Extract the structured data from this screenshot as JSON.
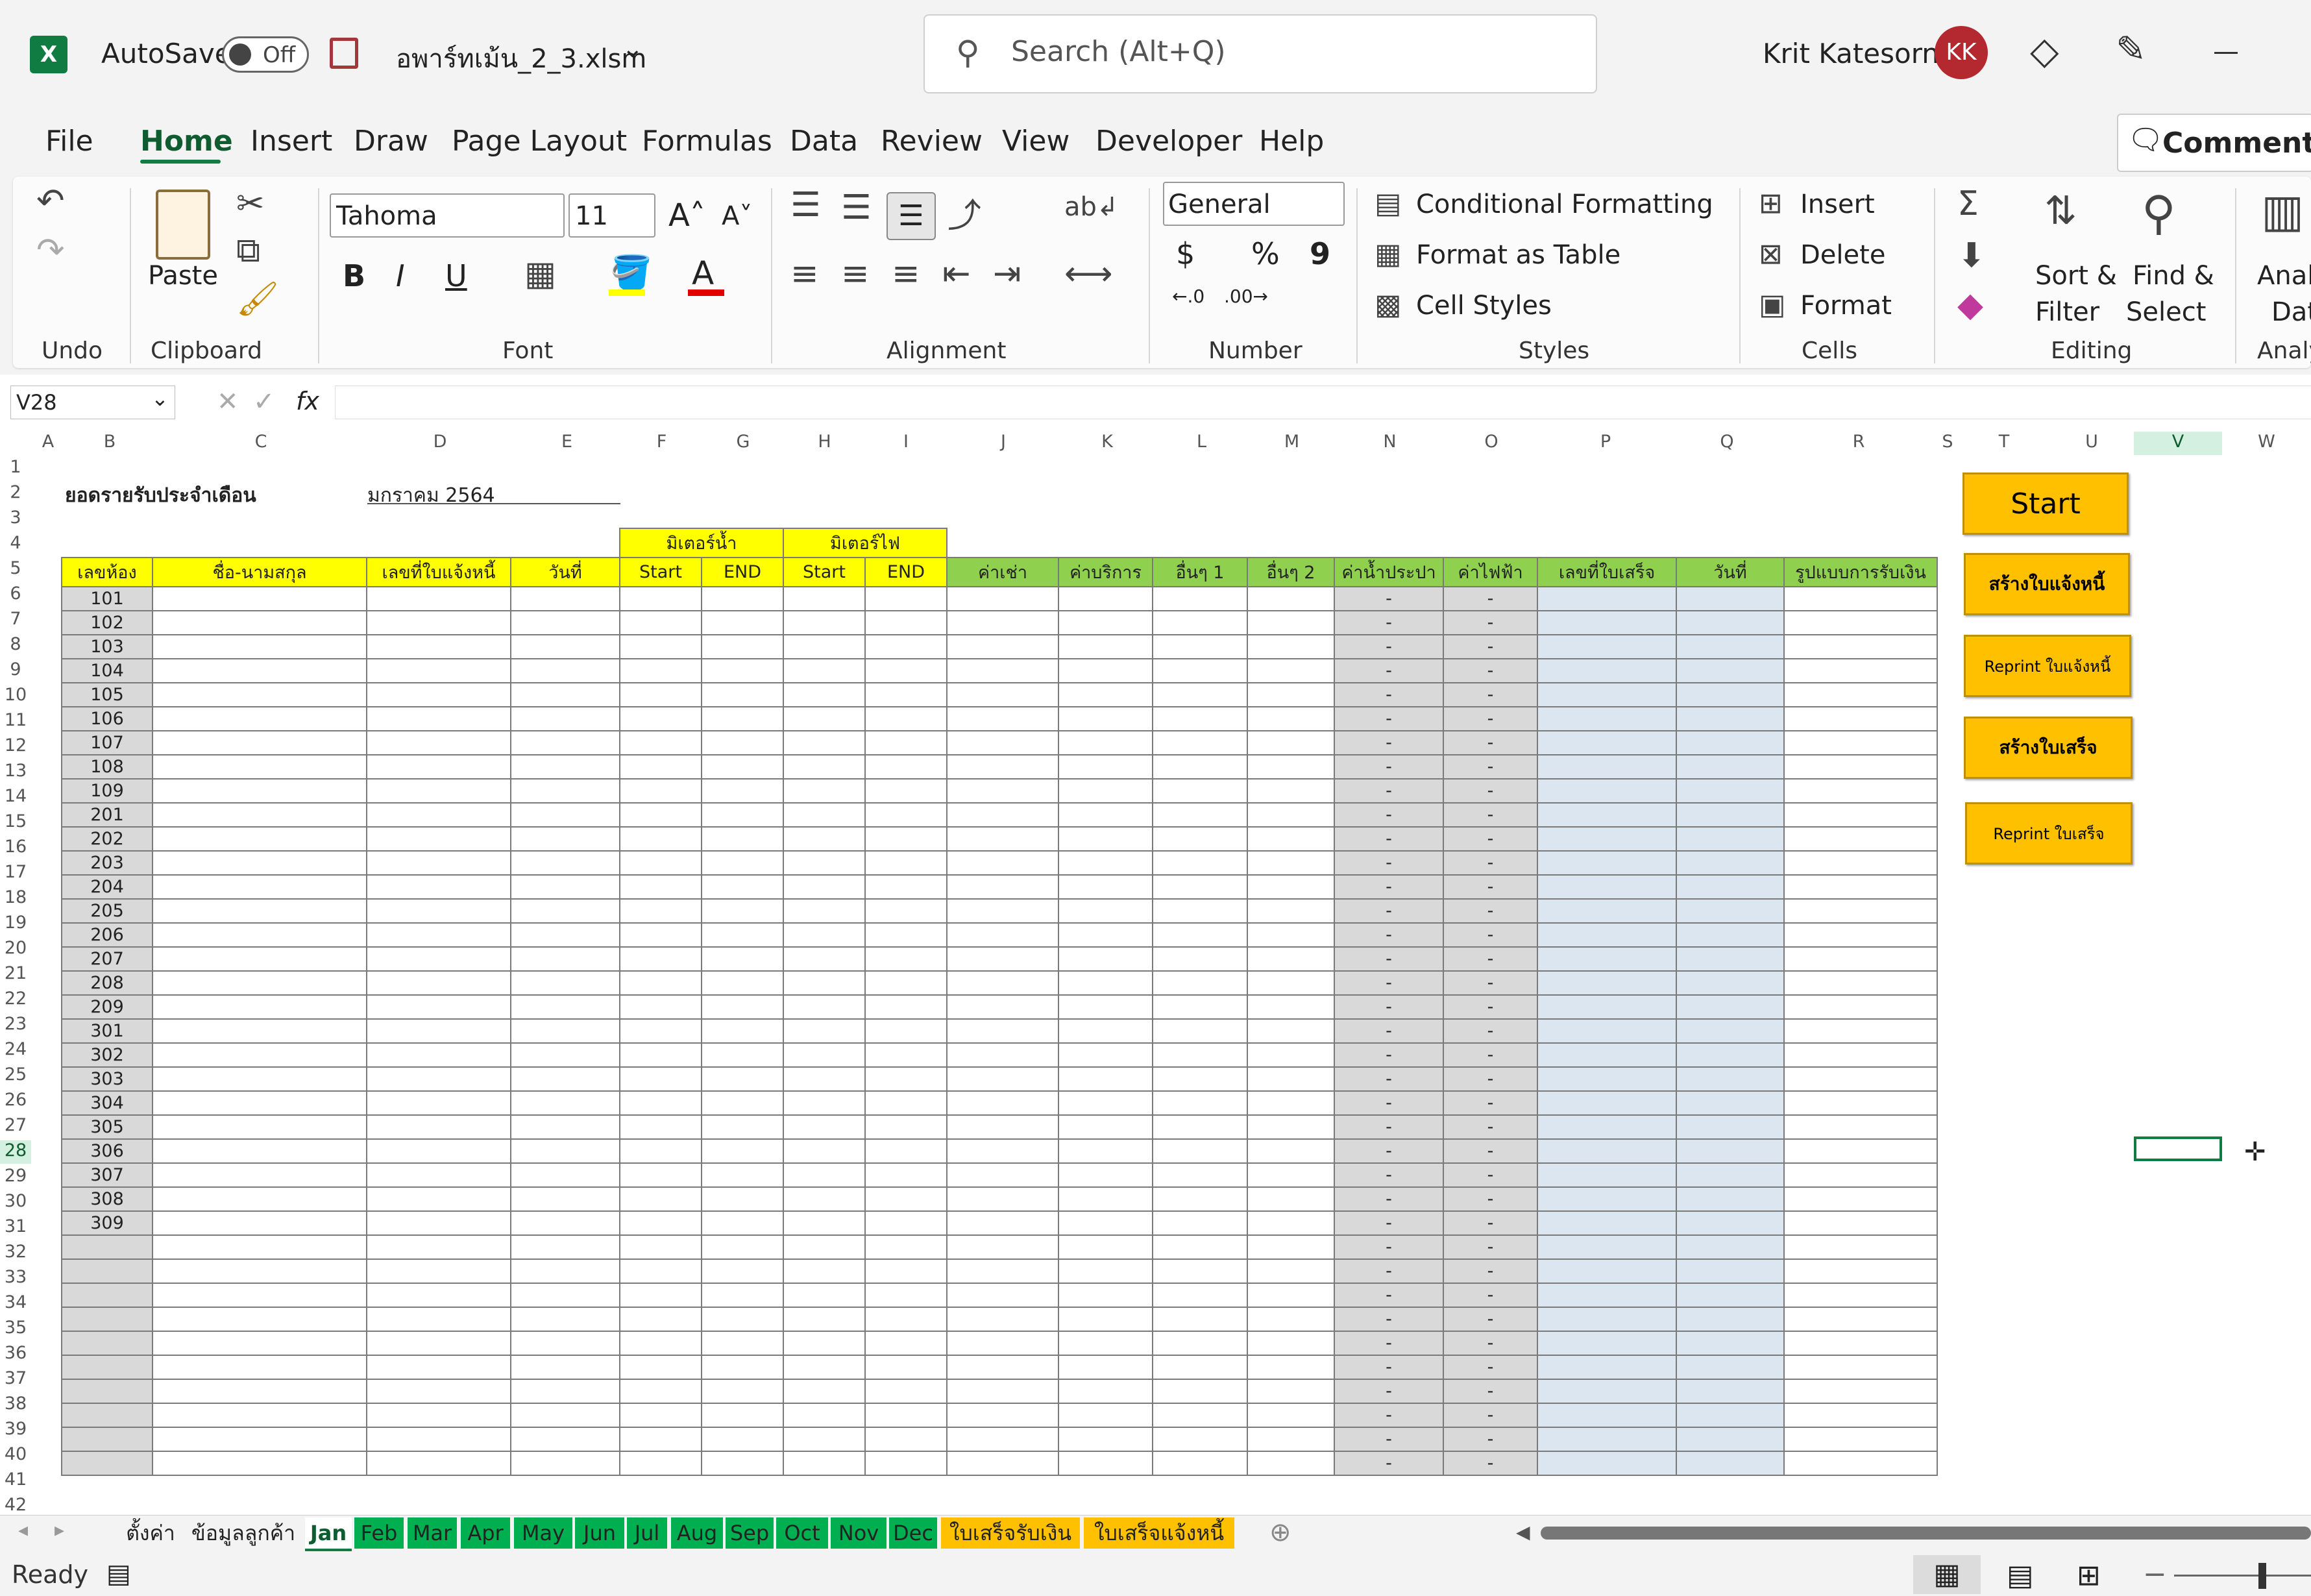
{
  "title_bar": {
    "autosave_label": "AutoSave",
    "autosave_state": "Off",
    "file_name": "อพาร์ทเม้น_2_3.xlsm",
    "search_placeholder": "Search (Alt+Q)",
    "user_name": "Krit Katesorn",
    "user_initials": "KK"
  },
  "menu": {
    "tabs": [
      "File",
      "Home",
      "Insert",
      "Draw",
      "Page Layout",
      "Formulas",
      "Data",
      "Review",
      "View",
      "Developer",
      "Help"
    ],
    "active": "Home",
    "comments_label": "Comments"
  },
  "ribbon": {
    "undo_group": "Undo",
    "clipboard": {
      "paste": "Paste",
      "group": "Clipboard"
    },
    "font": {
      "name": "Tahoma",
      "size": "11",
      "group": "Font",
      "bold": "B",
      "italic": "I",
      "underline": "U"
    },
    "alignment": {
      "group": "Alignment"
    },
    "number": {
      "format": "General",
      "group": "Number",
      "currency": "$",
      "percent": "%",
      "comma": "9"
    },
    "styles": {
      "conditional": "Conditional Formatting",
      "table": "Format as Table",
      "cell_styles": "Cell Styles",
      "group": "Styles"
    },
    "cells": {
      "insert": "Insert",
      "delete": "Delete",
      "format": "Format",
      "group": "Cells"
    },
    "editing": {
      "sort1": "Sort &",
      "sort2": "Filter",
      "find1": "Find &",
      "find2": "Select",
      "group": "Editing"
    },
    "analyze": {
      "label1": "Analy",
      "label2": "Dat",
      "group": "Analy"
    }
  },
  "formula_bar": {
    "name_box": "V28",
    "fx": "fx",
    "value": ""
  },
  "columns": [
    "A",
    "B",
    "C",
    "D",
    "E",
    "F",
    "G",
    "H",
    "I",
    "J",
    "K",
    "L",
    "M",
    "N",
    "O",
    "P",
    "Q",
    "R",
    "S",
    "T",
    "U",
    "V",
    "W"
  ],
  "rows": [
    "1",
    "2",
    "3",
    "4",
    "5",
    "6",
    "7",
    "8",
    "9",
    "10",
    "11",
    "12",
    "13",
    "14",
    "15",
    "16",
    "17",
    "18",
    "19",
    "20",
    "21",
    "22",
    "23",
    "24",
    "25",
    "26",
    "27",
    "28",
    "29",
    "30",
    "31",
    "32",
    "33",
    "34",
    "35",
    "36",
    "37",
    "38",
    "39",
    "40",
    "41",
    "42"
  ],
  "sheet": {
    "heading": "ยอดรายรับประจำเดือน",
    "month": "มกราคม 2564",
    "group_water": "มิเตอร์น้ำ",
    "group_electric": "มิเตอร์ไฟ",
    "headers": [
      "เลขห้อง",
      "ชื่อ-นามสกุล",
      "เลขที่ใบแจ้งหนี้",
      "วันที่",
      "Start",
      "END",
      "Start",
      "END",
      "ค่าเช่า",
      "ค่าบริการ",
      "อื่นๆ 1",
      "อื่นๆ 2",
      "ค่าน้ำประปา",
      "ค่าไฟฟ้า",
      "เลขที่ใบเสร็จ",
      "วันที่",
      "รูปแบบการรับเงิน"
    ],
    "rooms": [
      "101",
      "102",
      "103",
      "104",
      "105",
      "106",
      "107",
      "108",
      "109",
      "201",
      "202",
      "203",
      "204",
      "205",
      "206",
      "207",
      "208",
      "209",
      "301",
      "302",
      "303",
      "304",
      "305",
      "306",
      "307",
      "308",
      "309",
      "",
      "",
      "",
      "",
      "",
      "",
      "",
      "",
      "",
      ""
    ],
    "dash": "-"
  },
  "macros": {
    "start": "Start",
    "create_invoice": "สร้างใบแจ้งหนี้",
    "reprint_invoice": "Reprint ใบแจ้งหนี้",
    "create_receipt": "สร้างใบเสร็จ",
    "reprint_receipt": "Reprint ใบเสร็จ"
  },
  "sheet_tabs": [
    "ตั้งค่า",
    "ข้อมูลลูกค้า",
    "Jan",
    "Feb",
    "Mar",
    "Apr",
    "May",
    "Jun",
    "Jul",
    "Aug",
    "Sep",
    "Oct",
    "Nov",
    "Dec",
    "ใบเสร็จรับเงิน",
    "ใบเสร็จแจ้งหนี้"
  ],
  "active_tab": "Jan",
  "status": {
    "ready": "Ready"
  }
}
